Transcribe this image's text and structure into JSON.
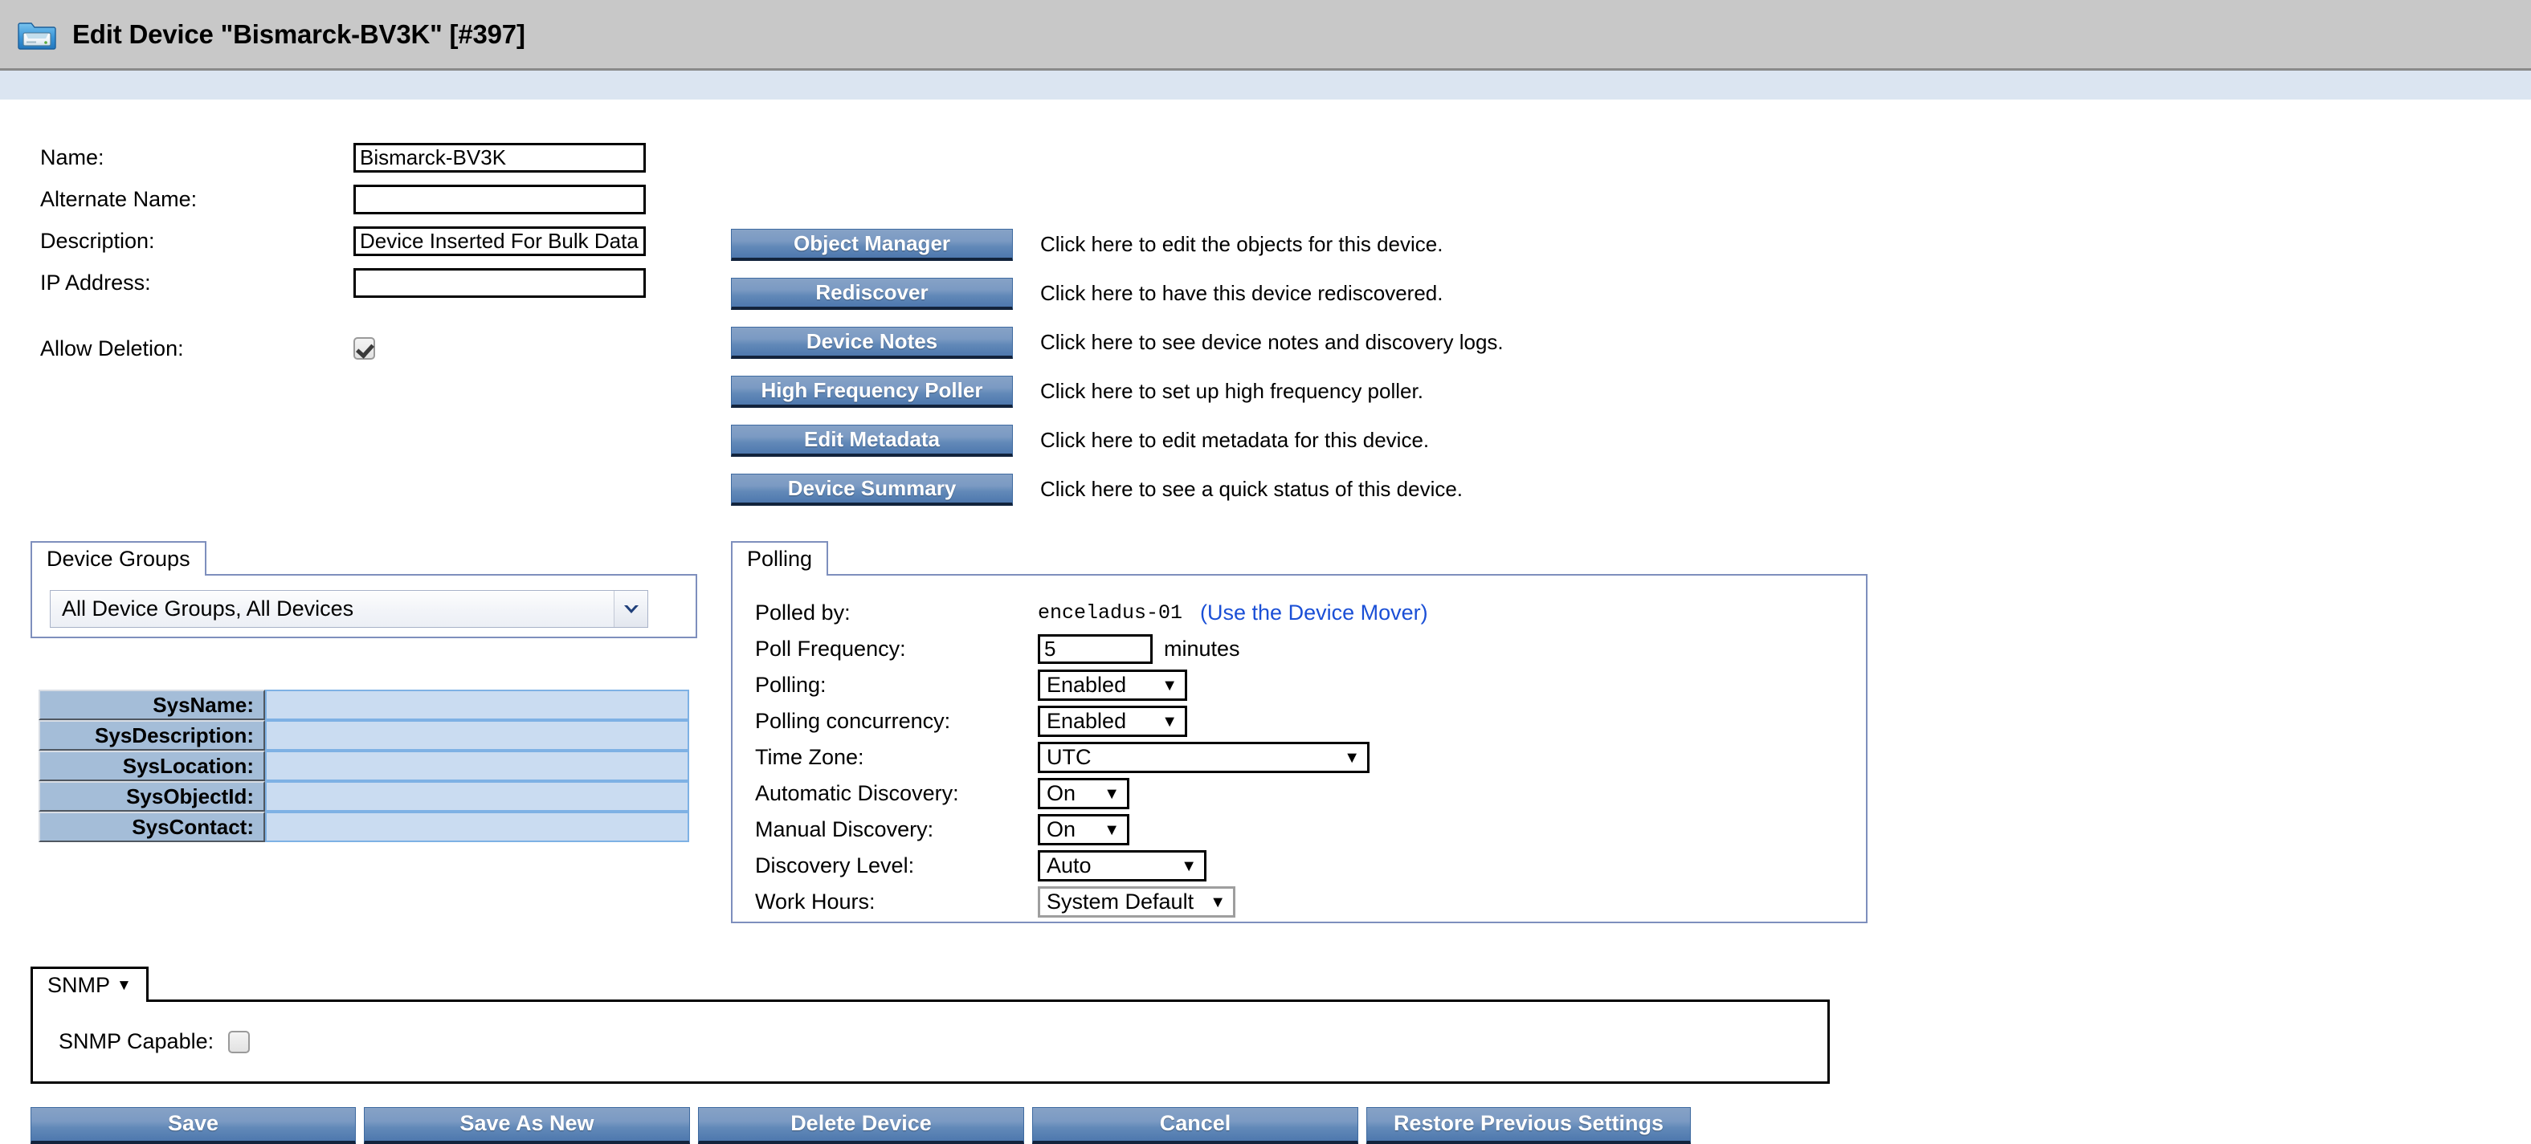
{
  "window": {
    "title": "Edit Device \"Bismarck-BV3K\" [#397]",
    "icon": "device-folder-icon"
  },
  "form": {
    "fields": [
      {
        "label": "Name:",
        "value": "Bismarck-BV3K",
        "name": "name"
      },
      {
        "label": "Alternate Name:",
        "value": "",
        "name": "alternate-name"
      },
      {
        "label": "Description:",
        "value": "Device Inserted For Bulk Data Testing",
        "name": "description"
      },
      {
        "label": "IP Address:",
        "value": "",
        "name": "ip-address"
      }
    ],
    "allow_deletion": {
      "label": "Allow Deletion:",
      "checked": true
    }
  },
  "actions": [
    {
      "label": "Object Manager",
      "help": "Click here to edit the objects for this device."
    },
    {
      "label": "Rediscover",
      "help": "Click here to have this device rediscovered."
    },
    {
      "label": "Device Notes",
      "help": "Click here to see device notes and discovery logs."
    },
    {
      "label": "High Frequency Poller",
      "help": "Click here to set up high frequency poller."
    },
    {
      "label": "Edit Metadata",
      "help": "Click here to edit metadata for this device."
    },
    {
      "label": "Device Summary",
      "help": "Click here to see a quick status of this device."
    }
  ],
  "device_groups": {
    "tab_label": "Device Groups",
    "selected": "All Device Groups, All Devices"
  },
  "sys_table": {
    "rows": [
      {
        "label": "SysName:",
        "value": ""
      },
      {
        "label": "SysDescription:",
        "value": ""
      },
      {
        "label": "SysLocation:",
        "value": ""
      },
      {
        "label": "SysObjectId:",
        "value": ""
      },
      {
        "label": "SysContact:",
        "value": ""
      }
    ]
  },
  "polling": {
    "tab_label": "Polling",
    "polled_by": {
      "label": "Polled by:",
      "value": "enceladus-01",
      "link": "(Use the Device Mover)"
    },
    "poll_frequency": {
      "label": "Poll Frequency:",
      "value": "5",
      "unit": "minutes"
    },
    "polling": {
      "label": "Polling:",
      "value": "Enabled"
    },
    "polling_concurrency": {
      "label": "Polling concurrency:",
      "value": "Enabled"
    },
    "time_zone": {
      "label": "Time Zone:",
      "value": "UTC"
    },
    "automatic_discovery": {
      "label": "Automatic Discovery:",
      "value": "On"
    },
    "manual_discovery": {
      "label": "Manual Discovery:",
      "value": "On"
    },
    "discovery_level": {
      "label": "Discovery Level:",
      "value": "Auto"
    },
    "work_hours": {
      "label": "Work Hours:",
      "value": "System Default"
    }
  },
  "snmp": {
    "tab_label": "SNMP",
    "capable_label": "SNMP Capable:",
    "capable_checked": false
  },
  "bottom_buttons": [
    {
      "label": "Save"
    },
    {
      "label": "Save As New"
    },
    {
      "label": "Delete Device"
    },
    {
      "label": "Cancel"
    },
    {
      "label": "Restore Previous Settings"
    }
  ],
  "colors": {
    "titlebar_bg": "#c8c8c8",
    "strip_bg": "#dbe5f1",
    "button_blue": "#6289b8",
    "link_blue": "#1a4fd6",
    "tab_border_blue": "#7e8fbd",
    "sys_label_bg": "#a4bdd8",
    "sys_value_bg": "#cadcf1"
  }
}
